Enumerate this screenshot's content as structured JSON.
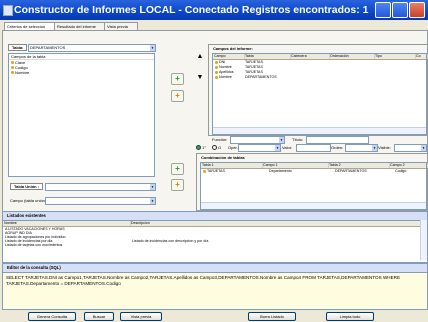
{
  "window": {
    "title": "Constructor de Informes LOCAL - Conectado Registros encontrados: 1",
    "minimize_icon": "minimize-icon",
    "maximize_icon": "maximize-icon",
    "close_icon": "close-icon"
  },
  "tabs": [
    "Criterios de selección",
    "Resultado del informe",
    "Vista previa"
  ],
  "left_panel": {
    "tabla_label": "Tabla:",
    "tabla_value": "DEPARTAMENTOS",
    "fields_header": "Campos de la tabla",
    "fields": [
      "Clave",
      "Codigo",
      "Nombre"
    ],
    "tabla_union_label": "Tabla Unión :",
    "campo_label": "Campo (tabla unión):"
  },
  "report_fields": {
    "title": "Campos del informe:",
    "columns": [
      "Campo",
      "Tabla",
      "Cabecera",
      "Ordenación",
      "Tipo",
      "Co"
    ],
    "rows": [
      {
        "campo": "DNI",
        "tabla": "TARJETAS"
      },
      {
        "campo": "Nombre",
        "tabla": "TARJETAS"
      },
      {
        "campo": "Apellidos",
        "tabla": "TARJETAS"
      },
      {
        "campo": "Nombre",
        "tabla": "DEPARTAMENTOS"
      }
    ],
    "funcion_label": "Función:",
    "titulo_label": "Título:",
    "radio_1": "1°",
    "radio_2": "O",
    "oper_label": "Oper.",
    "valor_label": "Valor:",
    "orden_label": "Orden:",
    "visible_label": "Visible:"
  },
  "join": {
    "title": "Combinación de tablas",
    "columns": [
      "Tabla 1",
      "Campo 1",
      "Tabla 2",
      "Campo 2"
    ],
    "rows": [
      {
        "tabla1": "TARJETAS",
        "campo1": "Departamento",
        "tabla2": "DEPARTAMENTOS",
        "campo2": "Codigo"
      }
    ]
  },
  "listados": {
    "title": "Listados existentes",
    "columns": [
      "Nombre",
      "Descripcion"
    ],
    "rows": [
      {
        "nombre": "A LISTADO VACACIONES Y HORAS",
        "desc": ""
      },
      {
        "nombre": "AGRUP IND DIA",
        "desc": ""
      },
      {
        "nombre": "Listado de agrupaciones por individuo",
        "desc": ""
      },
      {
        "nombre": "Listado de incidencias por dia",
        "desc": "Listado de incidencias con descripcion y por día"
      },
      {
        "nombre": "Listado de tarjetas con movimientos",
        "desc": ""
      }
    ]
  },
  "sql": {
    "title": "Editor de la consulta (SQL)",
    "text": "SELECT TARJETAS.DNI as Campo1,TARJETAS.Nombre as Campo2,TARJETAS.Apellidos as Campo3,DEPARTAMENTOS.Nombre as Campo4 FROM TARJETAS,DEPARTAMENTOS WHERE TARJETAS.Departamento = DEPARTAMENTOS.Codigo"
  },
  "buttons": [
    "Genera Consulta",
    "Buscar",
    "Vista previa",
    "Borra Listado",
    "Limpia todo"
  ]
}
